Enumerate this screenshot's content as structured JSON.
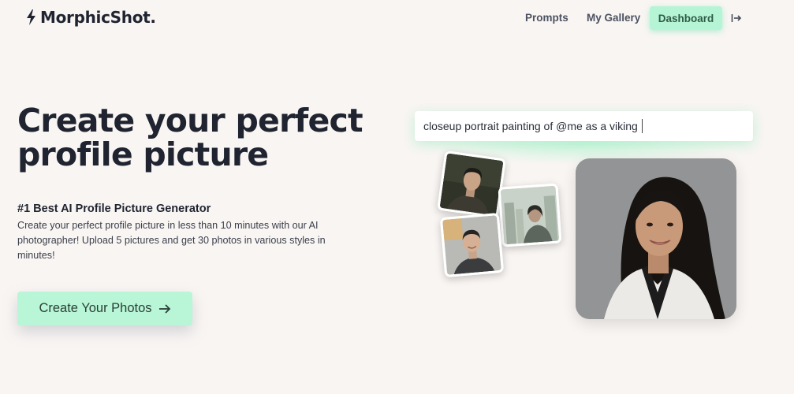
{
  "brand": {
    "name": "MorphicShot.",
    "icon": "lightning-bolt-icon"
  },
  "nav": {
    "prompts": "Prompts",
    "gallery": "My Gallery",
    "dashboard": "Dashboard",
    "logout_icon": "logout-icon"
  },
  "hero": {
    "title": "Create your perfect profile picture",
    "subtitle": "#1 Best AI Profile Picture Generator",
    "description": "Create your perfect profile picture in less than 10 minutes with our AI photographer! Upload 5 pictures and get 30 photos in various styles in minutes!",
    "cta_label": "Create Your Photos",
    "cta_icon": "arrow-right-icon"
  },
  "prompt": {
    "text": "closeup portrait painting of @me as a viking"
  },
  "colors": {
    "background": "#f9f5f3",
    "accent": "#b5f5d6",
    "text": "#1f2430"
  }
}
